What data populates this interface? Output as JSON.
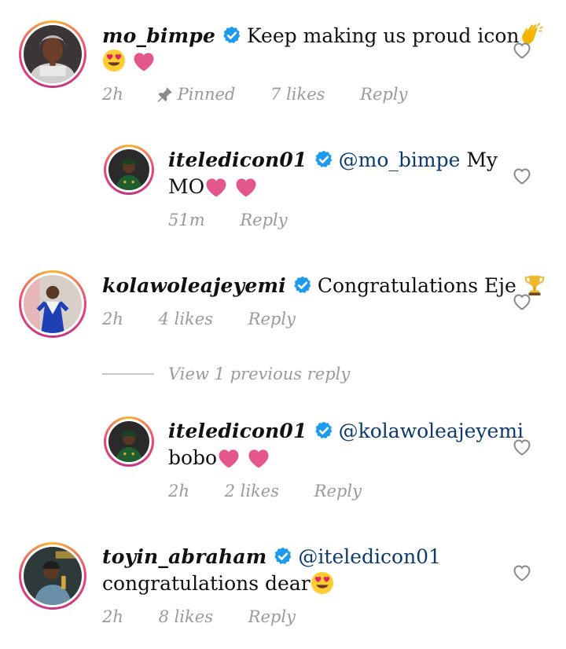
{
  "comments": [
    {
      "username": "mo_bimpe",
      "text": "Keep making us proud icon",
      "time": "2h",
      "pinned": "Pinned",
      "likes": "7 likes",
      "reply": "Reply"
    },
    {
      "username": "iteledicon01",
      "mention": "@mo_bimpe",
      "text_after_mention": " My",
      "text_line2": "MO",
      "time": "51m",
      "reply": "Reply"
    },
    {
      "username": "kolawoleajeyemi",
      "text": "Congratulations Eje",
      "time": "2h",
      "likes": "4 likes",
      "reply": "Reply"
    },
    {
      "username": "iteledicon01",
      "mention": "@kolawoleajeyemi",
      "text_line2": "bobo",
      "time": "2h",
      "likes": "2 likes",
      "reply": "Reply"
    },
    {
      "username": "toyin_abraham",
      "mention": "@iteledicon01",
      "text_line2": "congratulations dear",
      "time": "2h",
      "likes": "8 likes",
      "reply": "Reply"
    }
  ],
  "view_replies": "View 1 previous reply",
  "colors": {
    "verified": "#1d9bf0",
    "heart_emoji": "#e4578d",
    "meta_text": "#9a9a9a",
    "mention": "#0b3a6e"
  },
  "icons": [
    "verified-badge-icon",
    "heart-outline-icon",
    "pin-icon",
    "clapping-hands-emoji",
    "heart-eyes-emoji",
    "pink-heart-emoji",
    "trophy-emoji"
  ]
}
